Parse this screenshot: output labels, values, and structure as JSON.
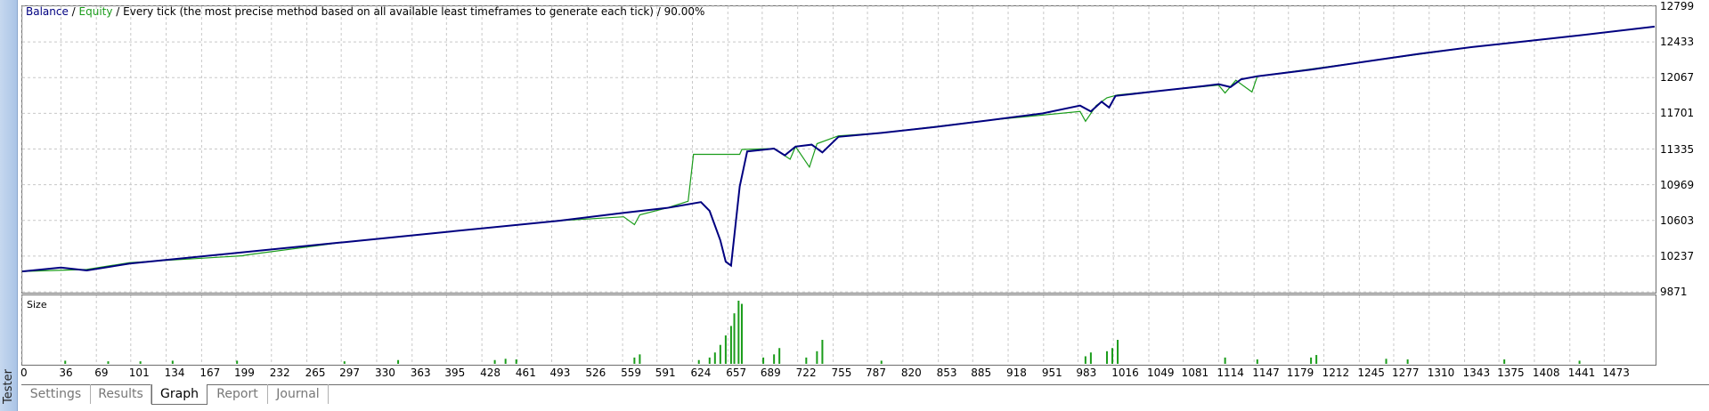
{
  "window": {
    "side_label": "Tester"
  },
  "legend": {
    "balance": "Balance",
    "sep1": " / ",
    "equity": "Equity",
    "rest": " / Every tick (the most precise method based on all available least timeframes to generate each tick) / 90.00%"
  },
  "volume_label": "Size",
  "tabs": [
    {
      "label": "Settings",
      "active": false
    },
    {
      "label": "Results",
      "active": false
    },
    {
      "label": "Graph",
      "active": true
    },
    {
      "label": "Report",
      "active": false
    },
    {
      "label": "Journal",
      "active": false
    }
  ],
  "colors": {
    "balance": "#000080",
    "equity": "#1a9c1a",
    "grid": "#c8c8c8",
    "volume": "#1a9c1a"
  },
  "chart_data": [
    {
      "type": "line",
      "title": "",
      "ylim": [
        9871,
        12799
      ],
      "y_ticks": [
        12799,
        12433,
        12067,
        11701,
        11335,
        10969,
        10603,
        10237,
        9871
      ],
      "x_ticks": [
        0,
        36,
        69,
        101,
        134,
        167,
        199,
        232,
        265,
        297,
        330,
        363,
        395,
        428,
        461,
        493,
        526,
        559,
        591,
        624,
        657,
        689,
        722,
        755,
        787,
        820,
        853,
        885,
        918,
        951,
        983,
        1016,
        1049,
        1081,
        1114,
        1147,
        1179,
        1212,
        1245,
        1277,
        1310,
        1343,
        1375,
        1408,
        1441,
        1473
      ],
      "xlim": [
        0,
        1520
      ],
      "grid": true,
      "series": [
        {
          "name": "Balance",
          "x": [
            0,
            36,
            60,
            100,
            200,
            300,
            400,
            500,
            560,
            600,
            632,
            640,
            650,
            655,
            660,
            668,
            675,
            700,
            710,
            720,
            735,
            745,
            760,
            800,
            850,
            900,
            950,
            985,
            995,
            1005,
            1012,
            1018,
            1050,
            1100,
            1114,
            1125,
            1135,
            1150,
            1200,
            1250,
            1300,
            1350,
            1400,
            1450,
            1520
          ],
          "values": [
            10080,
            10120,
            10090,
            10160,
            10270,
            10380,
            10490,
            10600,
            10680,
            10730,
            10790,
            10700,
            10400,
            10180,
            10140,
            10950,
            11310,
            11340,
            11270,
            11360,
            11380,
            11300,
            11460,
            11500,
            11560,
            11630,
            11700,
            11780,
            11720,
            11820,
            11760,
            11880,
            11920,
            11980,
            12000,
            11970,
            12050,
            12080,
            12150,
            12230,
            12310,
            12380,
            12440,
            12500,
            12590
          ]
        },
        {
          "name": "Equity",
          "x": [
            0,
            60,
            100,
            205,
            210,
            300,
            400,
            500,
            560,
            570,
            575,
            600,
            620,
            625,
            660,
            668,
            670,
            700,
            715,
            720,
            733,
            740,
            760,
            800,
            900,
            985,
            990,
            1000,
            1010,
            1020,
            1114,
            1120,
            1130,
            1145,
            1150,
            1250,
            1350,
            1450,
            1520
          ],
          "values": [
            10080,
            10100,
            10170,
            10240,
            10250,
            10380,
            10490,
            10600,
            10640,
            10560,
            10660,
            10730,
            10800,
            11280,
            11280,
            11280,
            11330,
            11340,
            11230,
            11360,
            11150,
            11390,
            11470,
            11500,
            11630,
            11720,
            11620,
            11780,
            11860,
            11890,
            11990,
            11910,
            12040,
            11920,
            12080,
            12230,
            12380,
            12500,
            12590
          ]
        }
      ]
    },
    {
      "type": "bar",
      "title": "Size",
      "series": [
        {
          "name": "",
          "x": [
            40,
            80,
            110,
            140,
            200,
            300,
            350,
            440,
            450,
            460,
            570,
            575,
            630,
            640,
            645,
            650,
            655,
            660,
            663,
            667,
            670,
            690,
            700,
            705,
            730,
            740,
            745,
            800,
            990,
            995,
            1010,
            1015,
            1020,
            1120,
            1150,
            1200,
            1205,
            1270,
            1290,
            1380,
            1450
          ],
          "values": [
            0.05,
            0.04,
            0.04,
            0.05,
            0.05,
            0.04,
            0.06,
            0.06,
            0.08,
            0.07,
            0.1,
            0.15,
            0.06,
            0.1,
            0.18,
            0.3,
            0.45,
            0.6,
            0.8,
            1.0,
            0.95,
            0.1,
            0.15,
            0.25,
            0.1,
            0.2,
            0.38,
            0.05,
            0.12,
            0.18,
            0.2,
            0.25,
            0.38,
            0.1,
            0.07,
            0.1,
            0.14,
            0.08,
            0.07,
            0.07,
            0.05
          ]
        }
      ]
    }
  ]
}
